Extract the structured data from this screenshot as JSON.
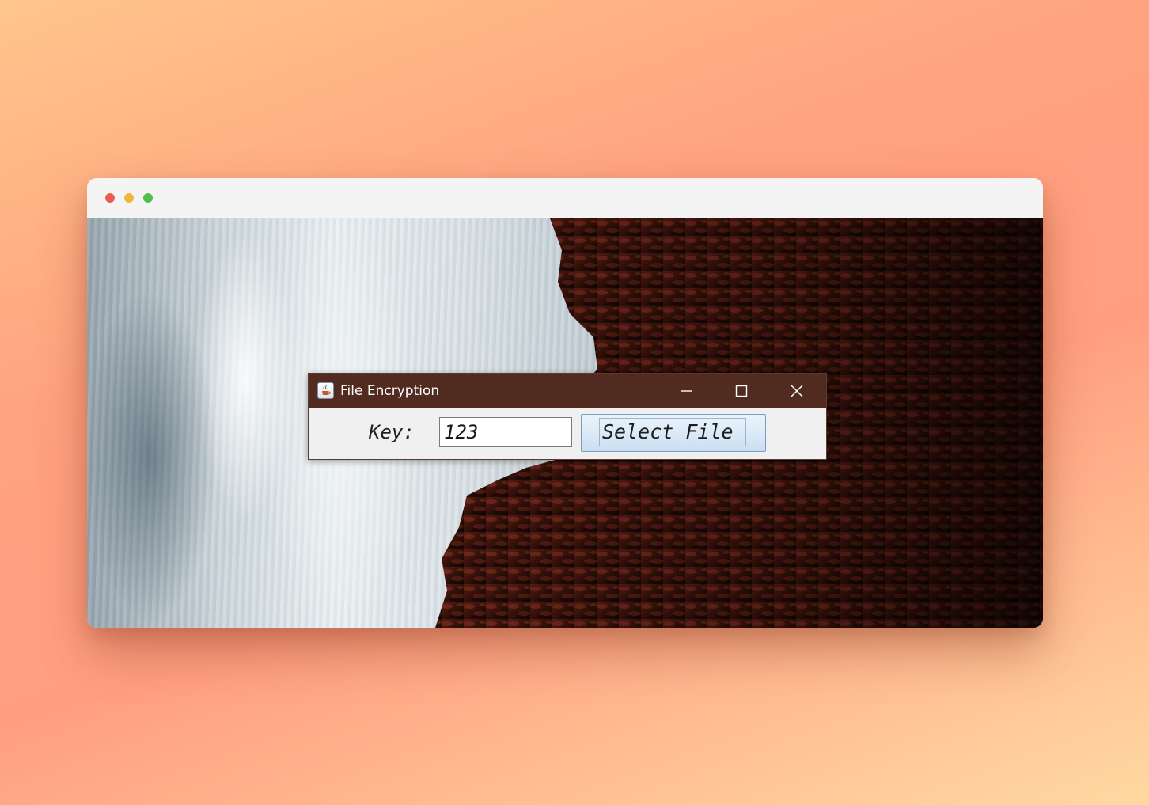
{
  "app": {
    "title": "File Encryption",
    "icon": "java-coffee-cup-icon"
  },
  "window_controls": {
    "minimize_icon": "minimize-icon",
    "maximize_icon": "maximize-icon",
    "close_icon": "close-icon"
  },
  "form": {
    "key_label": "Key:",
    "key_value": "123",
    "select_button_label": "Select File"
  },
  "colors": {
    "titlebar": "#512a20",
    "button_top": "#eaf3fb",
    "button_bottom": "#c9def1",
    "traffic_red": "#ed5b52",
    "traffic_yellow": "#f0b53a",
    "traffic_green": "#4fc04b"
  }
}
